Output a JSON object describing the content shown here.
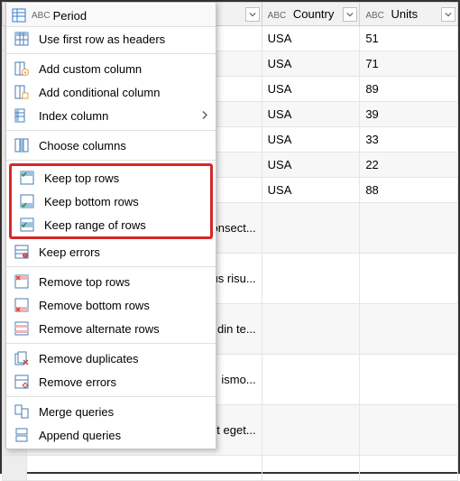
{
  "columns": {
    "period": {
      "label": "Period",
      "type_prefix": "ABC"
    },
    "country": {
      "label": "Country",
      "type_prefix": "ABC"
    },
    "units": {
      "label": "Units",
      "type_prefix": "ABC"
    }
  },
  "menu_header": {
    "label": "Period",
    "type_prefix": "ABC"
  },
  "menu": {
    "use_first_row": "Use first row as headers",
    "add_custom_col": "Add custom column",
    "add_conditional_col": "Add conditional column",
    "index_col": "Index column",
    "choose_cols": "Choose columns",
    "keep_top": "Keep top rows",
    "keep_bottom": "Keep bottom rows",
    "keep_range": "Keep range of rows",
    "keep_errors": "Keep errors",
    "remove_top": "Remove top rows",
    "remove_bottom": "Remove bottom rows",
    "remove_alternate": "Remove alternate rows",
    "remove_duplicates": "Remove duplicates",
    "remove_errors": "Remove errors",
    "merge_queries": "Merge queries",
    "append_queries": "Append queries"
  },
  "rows": [
    {
      "country": "USA",
      "units": "51"
    },
    {
      "country": "USA",
      "units": "71"
    },
    {
      "country": "USA",
      "units": "89"
    },
    {
      "country": "USA",
      "units": "39"
    },
    {
      "country": "USA",
      "units": "33"
    },
    {
      "country": "USA",
      "units": "22"
    },
    {
      "country": "USA",
      "units": "88"
    },
    {
      "period_suffix": "consect...",
      "country": "",
      "units": ""
    },
    {
      "period_suffix": "us risu...",
      "country": "",
      "units": ""
    },
    {
      "period_suffix": "din te...",
      "country": "",
      "units": ""
    },
    {
      "period_suffix": "ismo...",
      "country": "",
      "units": ""
    },
    {
      "period_suffix": "t eget...",
      "country": "",
      "units": ""
    },
    {
      "country": "",
      "units": ""
    }
  ]
}
